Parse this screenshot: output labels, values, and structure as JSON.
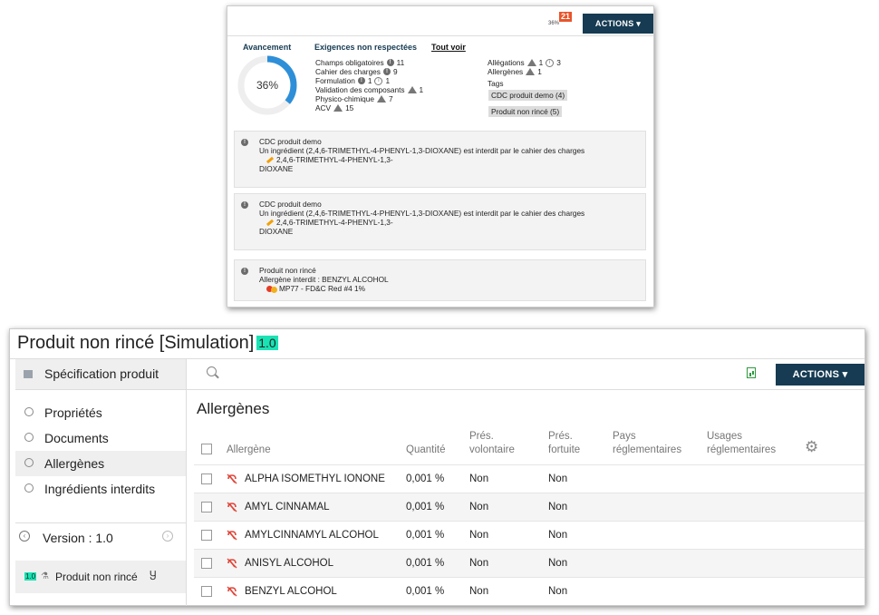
{
  "popup": {
    "mini_progress": "36%",
    "mini_badge": "21",
    "actions_label": "ACTIONS ▾",
    "progress_title": "Avancement",
    "progress_value": "36%",
    "progress_fraction": 0.36,
    "issues_title": "Exigences non respectées",
    "see_all": "Tout voir",
    "left_items": [
      {
        "label": "Champs obligatoires",
        "parts": [
          {
            "icon": "excl",
            "count": "11"
          }
        ]
      },
      {
        "label": "Cahier des charges",
        "parts": [
          {
            "icon": "excl",
            "count": "9"
          }
        ]
      },
      {
        "label": "Formulation",
        "parts": [
          {
            "icon": "excl",
            "count": "1"
          },
          {
            "icon": "info",
            "count": "1"
          }
        ]
      },
      {
        "label": "Validation des composants",
        "parts": [
          {
            "icon": "warn",
            "count": "1"
          }
        ]
      },
      {
        "label": "Physico-chimique",
        "parts": [
          {
            "icon": "warn",
            "count": "7"
          }
        ]
      },
      {
        "label": "ACV",
        "parts": [
          {
            "icon": "warn",
            "count": "15"
          }
        ]
      }
    ],
    "right_items": [
      {
        "label": "Allégations",
        "parts": [
          {
            "icon": "warn",
            "count": "1"
          },
          {
            "icon": "info",
            "count": "3"
          }
        ]
      },
      {
        "label": "Allergènes",
        "parts": [
          {
            "icon": "warn",
            "count": "1"
          }
        ]
      }
    ],
    "tags_label": "Tags",
    "tags": [
      "CDC produit demo (4)",
      "Produit non rincé (5)"
    ],
    "messages": [
      {
        "source": "CDC produit demo",
        "text": "Un ingrédient (2,4,6-TRIMETHYL-4-PHENYL-1,3-DIOXANE) est interdit par le cahier des charges",
        "detail_line1": "2,4,6-TRIMETHYL-4-PHENYL-1,3-",
        "detail_line2": "DIOXANE"
      },
      {
        "source": "CDC produit demo",
        "text": "Un ingrédient (2,4,6-TRIMETHYL-4-PHENYL-1,3-DIOXANE) est interdit par le cahier des charges",
        "detail_line1": "2,4,6-TRIMETHYL-4-PHENYL-1,3-",
        "detail_line2": "DIOXANE"
      },
      {
        "source": "Produit non rincé",
        "text": "Allergène interdit : BENZYL ALCOHOL",
        "detail_line1": "MP77 - FD&C Red #4 1%"
      }
    ]
  },
  "main": {
    "title": "Produit non rincé [Simulation]",
    "version_badge": "1.0",
    "sidebar": {
      "spec_label": "Spécification produit",
      "items": [
        {
          "label": "Propriétés",
          "active": false
        },
        {
          "label": "Documents",
          "active": false
        },
        {
          "label": "Allergènes",
          "active": true
        },
        {
          "label": "Ingrédients interdits",
          "active": false
        }
      ],
      "version_label": "Version : 1.0",
      "product_badge": "1.0",
      "product_label": "Produit non rincé"
    },
    "toolbar": {
      "search_placeholder": "",
      "actions_label": "ACTIONS ▾"
    },
    "section_title": "Allergènes",
    "columns": {
      "allergen": "Allergène",
      "quantity": "Quantité",
      "voluntary_line1": "Prés.",
      "voluntary_line2": "volontaire",
      "fortuitous_line1": "Prés.",
      "fortuitous_line2": "fortuite",
      "countries_line1": "Pays",
      "countries_line2": "réglementaires",
      "usages_line1": "Usages",
      "usages_line2": "réglementaires"
    },
    "rows": [
      {
        "name": "ALPHA ISOMETHYL IONONE",
        "quantity": "0,001 %",
        "voluntary": "Non",
        "fortuitous": "Non"
      },
      {
        "name": "AMYL CINNAMAL",
        "quantity": "0,001 %",
        "voluntary": "Non",
        "fortuitous": "Non"
      },
      {
        "name": "AMYLCINNAMYL ALCOHOL",
        "quantity": "0,001 %",
        "voluntary": "Non",
        "fortuitous": "Non"
      },
      {
        "name": "ANISYL ALCOHOL",
        "quantity": "0,001 %",
        "voluntary": "Non",
        "fortuitous": "Non"
      },
      {
        "name": "BENZYL ALCOHOL",
        "quantity": "0,001 %",
        "voluntary": "Non",
        "fortuitous": "Non"
      }
    ],
    "colors": {
      "accent": "#163b52",
      "version": "#19e3b4",
      "progress": "#2e8fd8"
    }
  }
}
